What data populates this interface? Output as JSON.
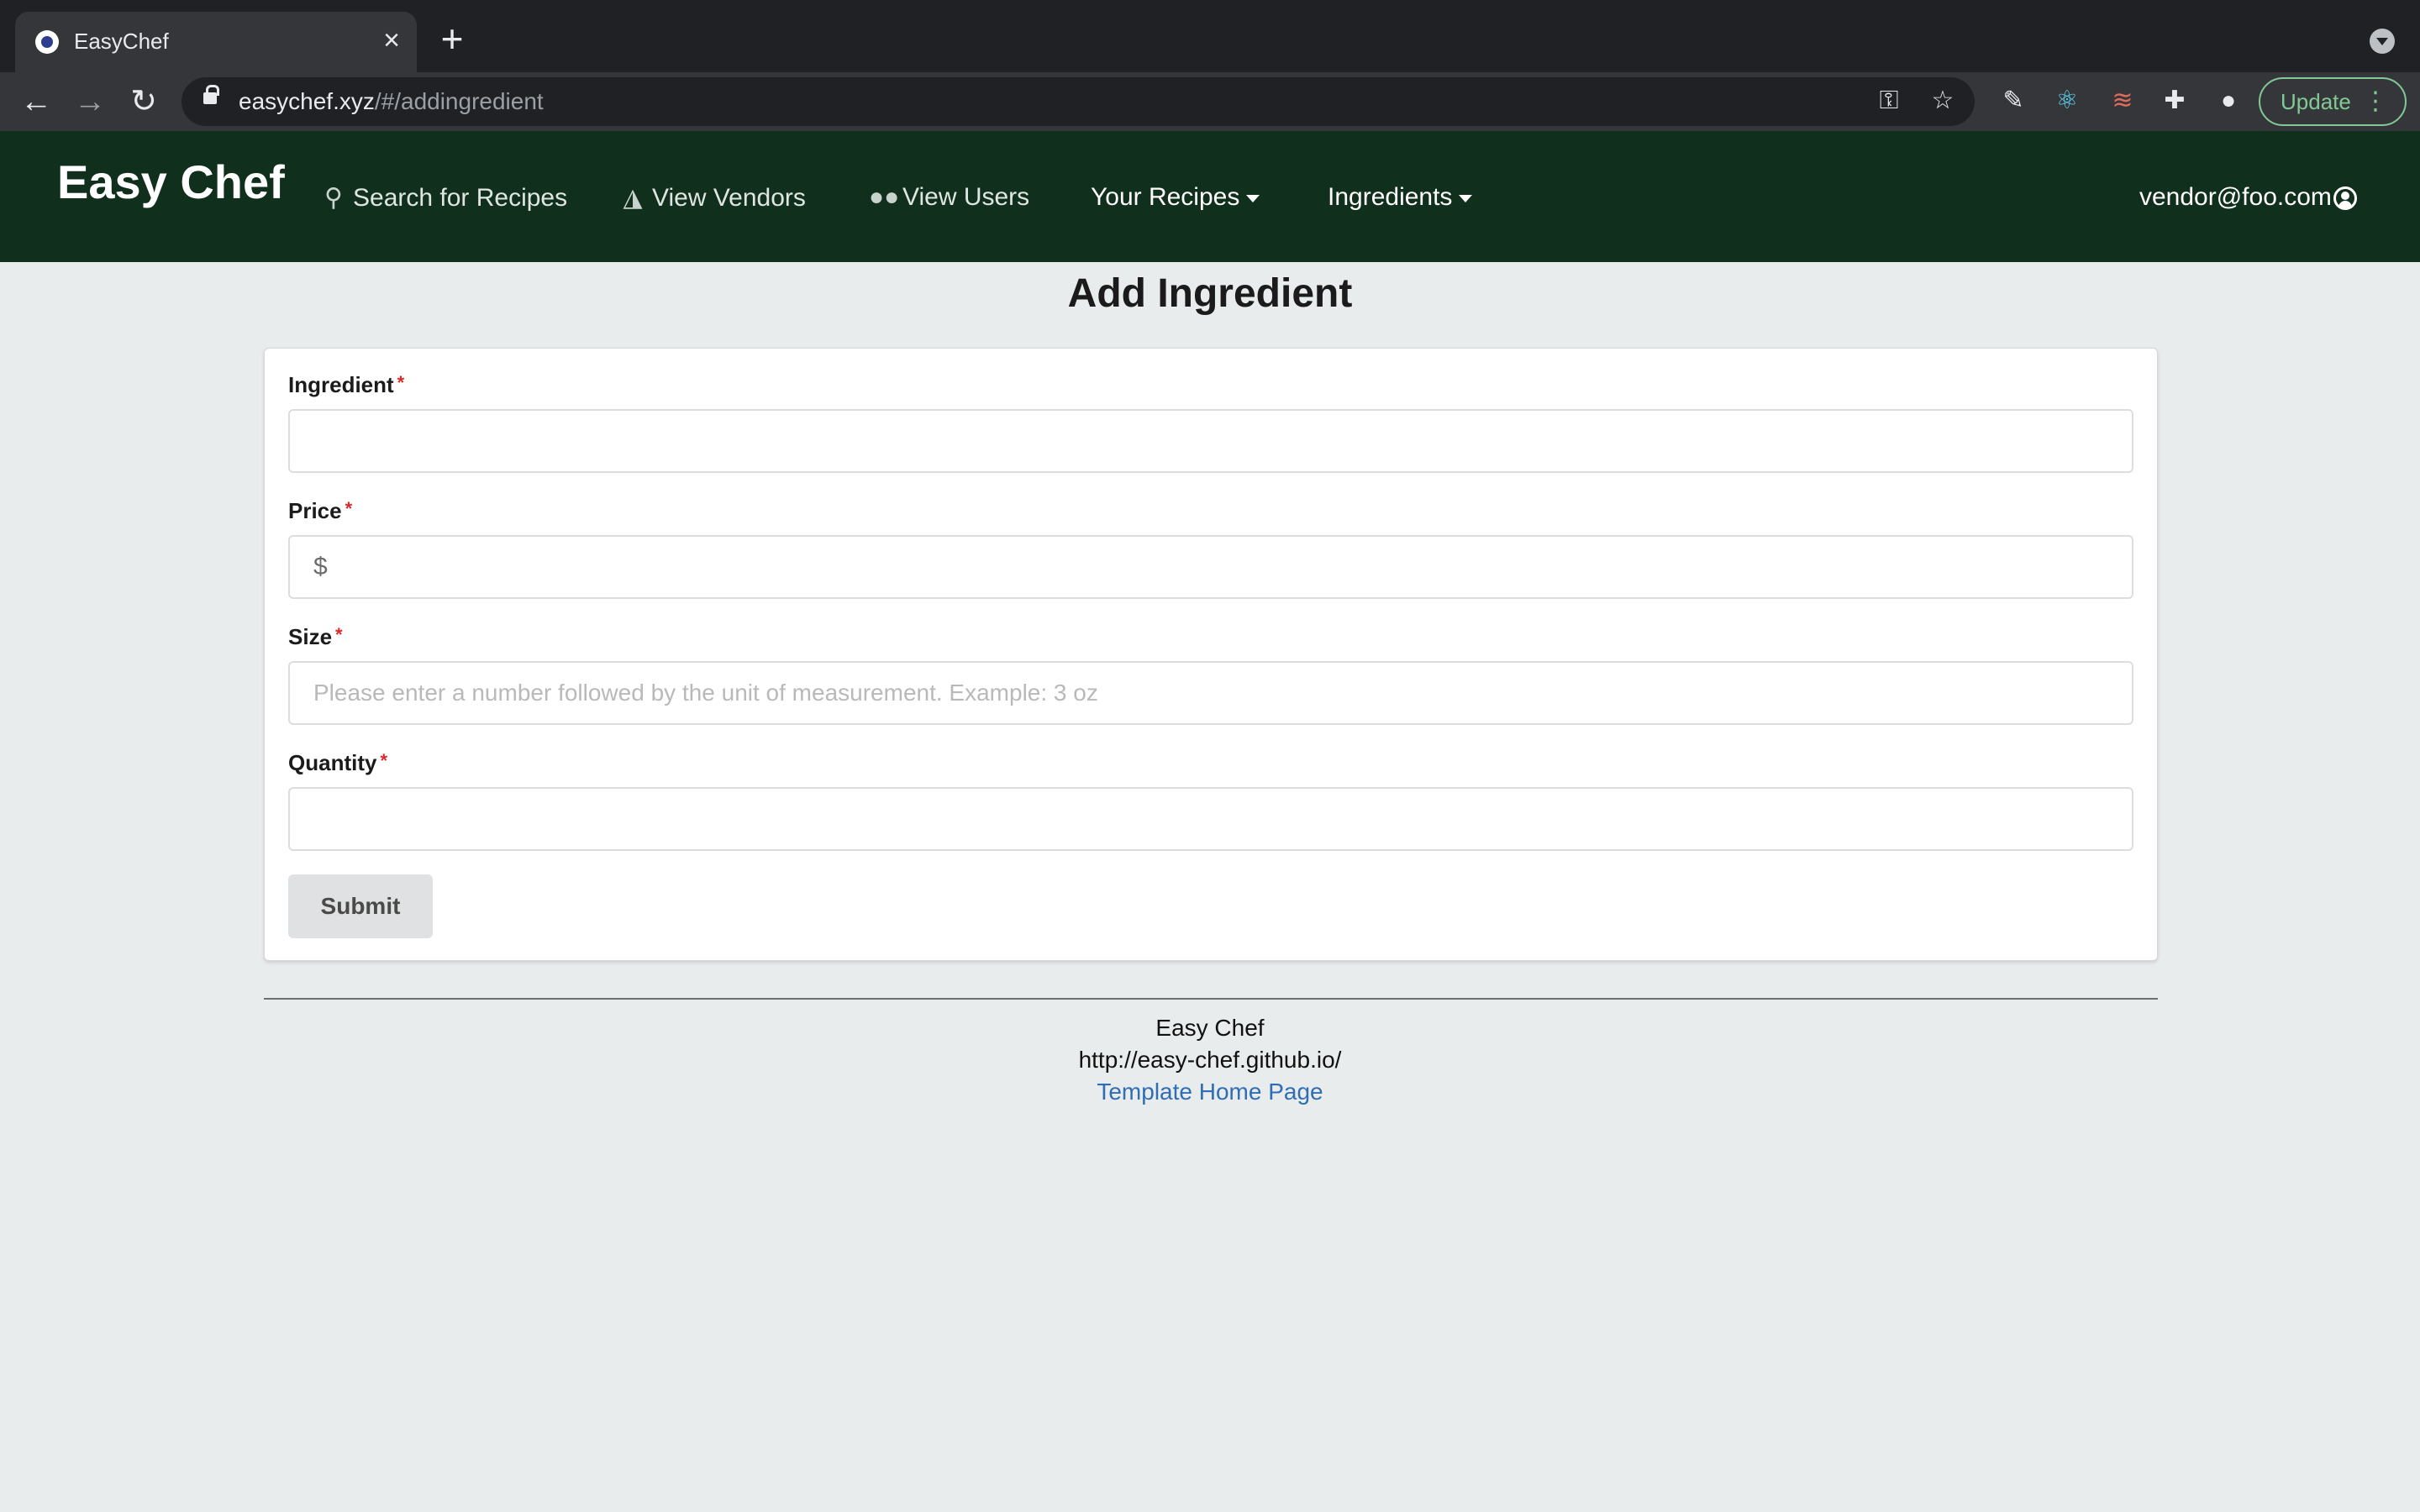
{
  "browser": {
    "tab_title": "EasyChef",
    "url_host": "easychef.xyz",
    "url_path": "/#/addingredient",
    "update_label": "Update"
  },
  "nav": {
    "brand": "Easy Chef",
    "search_recipes": "Search for Recipes",
    "view_vendors": "View Vendors",
    "view_users": "View Users",
    "your_recipes": "Your Recipes",
    "ingredients": "Ingredients",
    "user_email": "vendor@foo.com"
  },
  "form": {
    "title": "Add Ingredient",
    "ingredient_label": "Ingredient",
    "ingredient_value": "",
    "price_label": "Price",
    "price_prefix": "$",
    "price_value": "",
    "size_label": "Size",
    "size_placeholder": "Please enter a number followed by the unit of measurement. Example: 3 oz",
    "quantity_label": "Quantity",
    "quantity_value": "",
    "required_marker": "*",
    "submit_label": "Submit"
  },
  "footer": {
    "name": "Easy Chef",
    "url": "http://easy-chef.github.io/",
    "link_label": "Template Home Page"
  },
  "icons": {
    "search": "search-icon",
    "vendors": "shopping-basket-icon",
    "users": "users-icon",
    "user": "user-circle-icon"
  },
  "colors": {
    "navbar": "#112f1d",
    "page_background": "#e8ecec",
    "required": "#db2828",
    "link": "#2f6db5",
    "update_accent": "#81c995"
  }
}
